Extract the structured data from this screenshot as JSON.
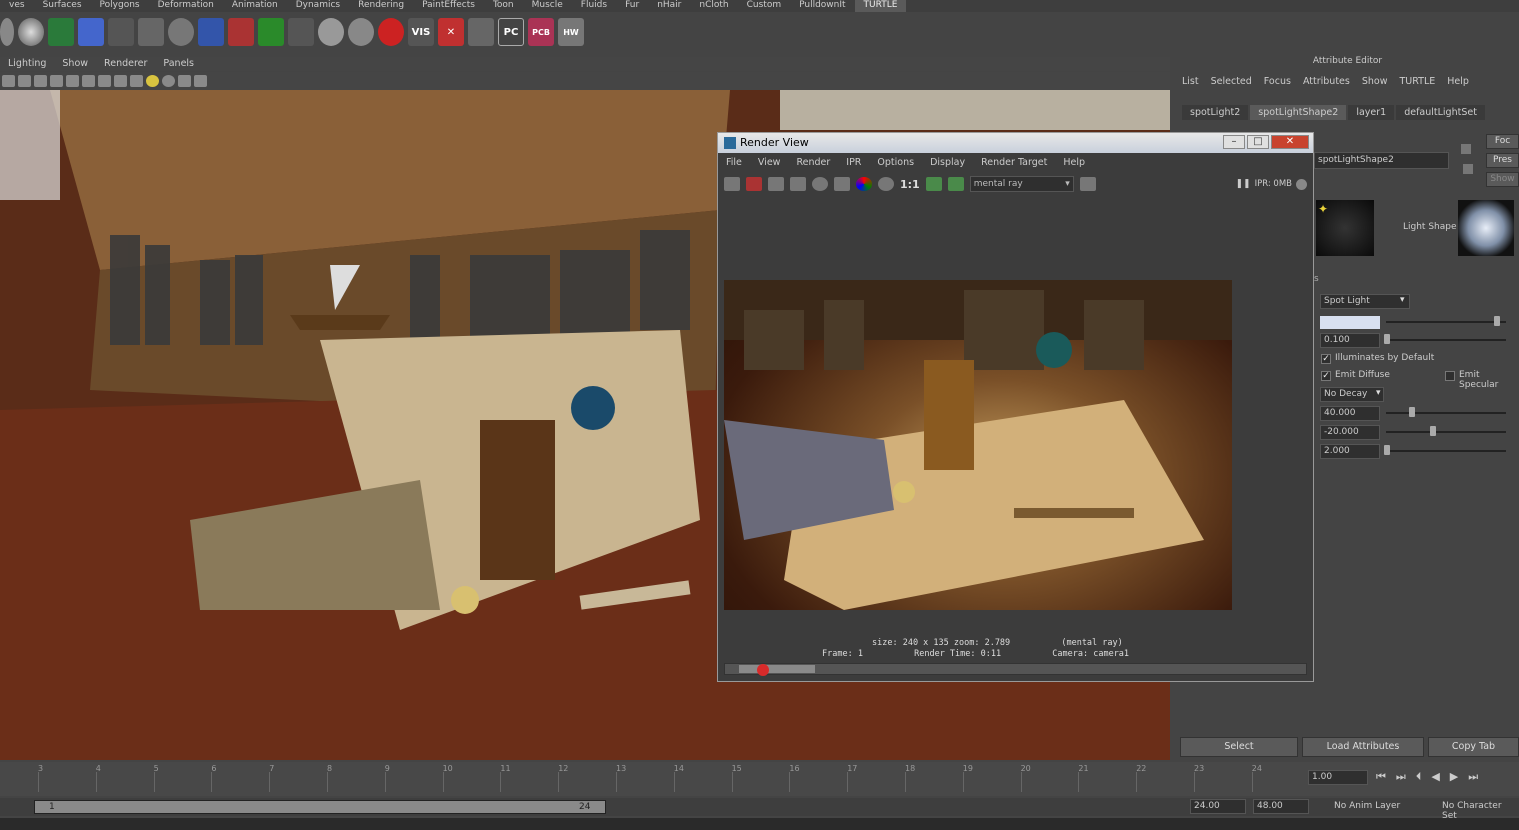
{
  "shelf_tabs": [
    "ves",
    "Surfaces",
    "Polygons",
    "Deformation",
    "Animation",
    "Dynamics",
    "Rendering",
    "PaintEffects",
    "Toon",
    "Muscle",
    "Fluids",
    "Fur",
    "nHair",
    "nCloth",
    "Custom",
    "PulldownIt",
    "TURTLE"
  ],
  "shelf_labels": {
    "vis": "VIS",
    "pc": "PC",
    "pcb": "PCB",
    "hw1": "HW",
    "hw2": "HW"
  },
  "viewport_menu": [
    "Lighting",
    "Show",
    "Renderer",
    "Panels"
  ],
  "render_view": {
    "title": "Render View",
    "menu": [
      "File",
      "View",
      "Render",
      "IPR",
      "Options",
      "Display",
      "Render Target",
      "Help"
    ],
    "ratio": "1:1",
    "renderer": "mental ray",
    "ipr": "IPR: 0MB",
    "status_line1": "size: 240 x 135 zoom: 2.789          (mental ray)",
    "status_line2": "Frame: 1          Render Time: 0:11          Camera: camera1"
  },
  "attribute_editor": {
    "title": "Attribute Editor",
    "menu": [
      "List",
      "Selected",
      "Focus",
      "Attributes",
      "Show",
      "TURTLE",
      "Help"
    ],
    "tabs": [
      "spotLight2",
      "spotLightShape2",
      "layer1",
      "defaultLightSet"
    ],
    "node_name": "spotLightShape2",
    "focus_btn": "Foc",
    "presets_btn": "Pres",
    "show_btn": "Show",
    "light_shape_label": "Light Shape",
    "section_s": "s",
    "type": "Spot Light",
    "intensity": "0.100",
    "illuminates_default": "Illuminates by Default",
    "emit_diffuse": "Emit Diffuse",
    "emit_specular": "Emit Specular",
    "decay": "No Decay",
    "cone_angle": "40.000",
    "penumbra": "-20.000",
    "dropoff": "2.000",
    "buttons": {
      "select": "Select",
      "load": "Load Attributes",
      "copy": "Copy Tab"
    }
  },
  "timeline": {
    "ticks": [
      "3",
      "4",
      "5",
      "6",
      "7",
      "8",
      "9",
      "10",
      "11",
      "12",
      "13",
      "14",
      "15",
      "16",
      "17",
      "18",
      "19",
      "20",
      "21",
      "22",
      "23",
      "24"
    ],
    "current_frame": "1.00"
  },
  "range": {
    "start": "1",
    "end": "24",
    "anim_end": "24.00",
    "total_end": "48.00",
    "anim_layer": "No Anim Layer",
    "char_set": "No Character Set"
  },
  "colors": {
    "accent_red": "#c8432e",
    "panel": "#444444",
    "field": "#2f2f2f"
  }
}
